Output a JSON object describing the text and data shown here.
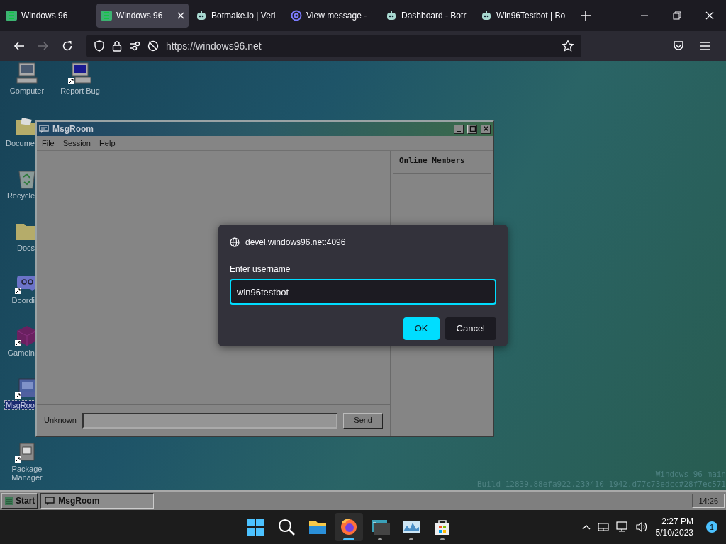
{
  "browser": {
    "tabs": [
      {
        "label": "Windows 96",
        "selected": false,
        "kind": "win96"
      },
      {
        "label": "Windows 96",
        "selected": true,
        "kind": "win96"
      },
      {
        "label": "Botmake.io | Veri",
        "selected": false,
        "kind": "bot"
      },
      {
        "label": "View message - ",
        "selected": false,
        "kind": "mail"
      },
      {
        "label": "Dashboard - Botr",
        "selected": false,
        "kind": "bot"
      },
      {
        "label": "Win96Testbot | Bo",
        "selected": false,
        "kind": "bot"
      }
    ],
    "url": "https://windows96.net"
  },
  "desktop_icons": [
    {
      "label": "Computer",
      "kind": "computer",
      "selected": false
    },
    {
      "label": "Report Bug",
      "kind": "computer-shortcut",
      "selected": false
    },
    {
      "label": "Docume",
      "kind": "folder-docs",
      "selected": false
    },
    {
      "label": "Recycle",
      "kind": "recycle",
      "selected": false
    },
    {
      "label": "Docs",
      "kind": "folder",
      "selected": false
    },
    {
      "label": "Doordi",
      "kind": "chat",
      "selected": false
    },
    {
      "label": "Gamein",
      "kind": "cube",
      "selected": false
    },
    {
      "label": "MsgRoo",
      "kind": "msgroom",
      "selected": true
    },
    {
      "label": "Package Manager",
      "kind": "package",
      "selected": false
    }
  ],
  "msgroom": {
    "title": "MsgRoom",
    "menu": [
      "File",
      "Session",
      "Help"
    ],
    "members_header": "Online Members",
    "nick": "Unknown",
    "send": "Send"
  },
  "dialog": {
    "host": "devel.windows96.net:4096",
    "label": "Enter username",
    "value": "win96testbot",
    "buttons": [
      {
        "label": "OK",
        "primary": true
      },
      {
        "label": "Cancel",
        "primary": false
      }
    ]
  },
  "watermark": [
    "Windows 96 main",
    "Build 12839.88efa922.230410-1942.d77c73edcc#28f7ec571"
  ],
  "win96_taskbar": {
    "start": "Start",
    "tasks": [
      {
        "label": "MsgRoom",
        "selected": true
      }
    ],
    "clock": "14:26"
  },
  "os_taskbar": {
    "apps": [
      {
        "kind": "start",
        "active": false,
        "running": false
      },
      {
        "kind": "search",
        "active": false,
        "running": false
      },
      {
        "kind": "explorer",
        "active": false,
        "running": false
      },
      {
        "kind": "firefox",
        "active": true,
        "running": true
      },
      {
        "kind": "terminal",
        "active": false,
        "running": true
      },
      {
        "kind": "monitor",
        "active": false,
        "running": true
      },
      {
        "kind": "store",
        "active": false,
        "running": true
      }
    ],
    "time": "2:27 PM",
    "date": "5/10/2023",
    "notifications": "1"
  }
}
